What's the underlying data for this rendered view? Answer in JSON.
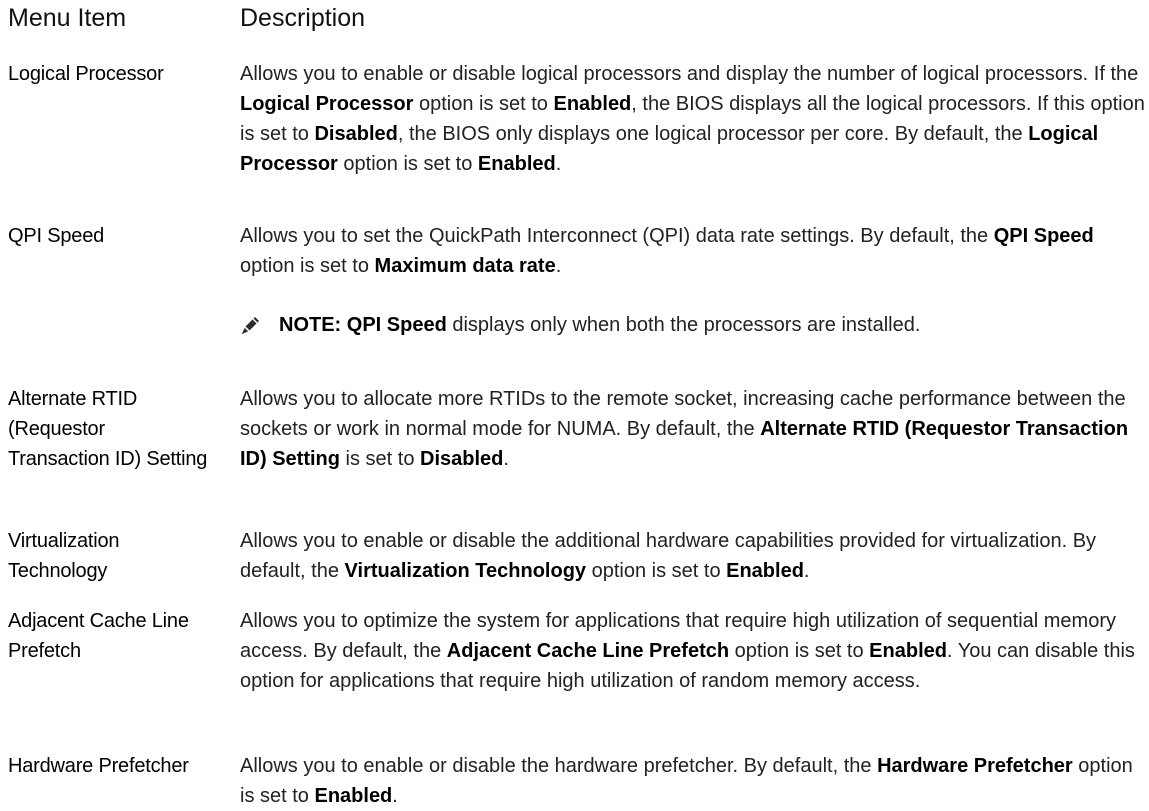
{
  "headers": {
    "menu_item": "Menu Item",
    "description": "Description"
  },
  "rows": [
    {
      "term": "Logical Processor",
      "segments": [
        {
          "t": "Allows you to enable or disable logical processors and display the number of logical processors. If the "
        },
        {
          "t": "Logical Processor",
          "b": true
        },
        {
          "t": " option is set to "
        },
        {
          "t": "Enabled",
          "b": true
        },
        {
          "t": ", the BIOS displays all the logical processors. If this option is set to "
        },
        {
          "t": "Disabled",
          "b": true
        },
        {
          "t": ", the BIOS only displays one logical processor per core. By default, the "
        },
        {
          "t": "Logical Processor",
          "b": true
        },
        {
          "t": " option is set to "
        },
        {
          "t": "Enabled",
          "b": true
        },
        {
          "t": "."
        }
      ]
    },
    {
      "term": "QPI Speed",
      "segments": [
        {
          "t": "Allows you to set the QuickPath Interconnect (QPI) data rate settings. By default, the "
        },
        {
          "t": "QPI Speed",
          "b": true
        },
        {
          "t": " option is set to "
        },
        {
          "t": "Maximum data rate",
          "b": true
        },
        {
          "t": "."
        }
      ],
      "note": {
        "icon": "pencil-note-icon",
        "prefix": "NOTE: ",
        "bold": "QPI Speed",
        "rest": " displays only when both the processors are installed."
      }
    },
    {
      "term": "Alternate RTID (Requestor Transaction ID) Setting",
      "segments": [
        {
          "t": "Allows you to allocate more RTIDs to the remote socket, increasing cache performance between the sockets or work in normal mode for NUMA. By default, the "
        },
        {
          "t": "Alternate RTID (Requestor Transaction ID) Setting",
          "b": true
        },
        {
          "t": " is set to "
        },
        {
          "t": "Disabled",
          "b": true
        },
        {
          "t": "."
        }
      ]
    },
    {
      "term": "Virtualization Technology",
      "segments": [
        {
          "t": "Allows you to enable or disable the additional hardware capabilities provided for virtualization. By default, the "
        },
        {
          "t": "Virtualization Technology",
          "b": true
        },
        {
          "t": " option is set to "
        },
        {
          "t": "Enabled",
          "b": true
        },
        {
          "t": "."
        }
      ]
    },
    {
      "term": "Adjacent Cache Line Prefetch",
      "segments": [
        {
          "t": "Allows you to optimize the system for applications that require high utilization of sequential memory access. By default, the "
        },
        {
          "t": "Adjacent Cache Line Prefetch",
          "b": true
        },
        {
          "t": " option is set to "
        },
        {
          "t": "Enabled",
          "b": true
        },
        {
          "t": ". You can disable this option for applications that require high utilization of random memory access."
        }
      ]
    },
    {
      "term": "Hardware Prefetcher",
      "segments": [
        {
          "t": "Allows you to enable or disable the hardware prefetcher. By default, the "
        },
        {
          "t": "Hardware Prefetcher",
          "b": true
        },
        {
          "t": " option is set to "
        },
        {
          "t": "Enabled",
          "b": true
        },
        {
          "t": "."
        }
      ]
    }
  ]
}
